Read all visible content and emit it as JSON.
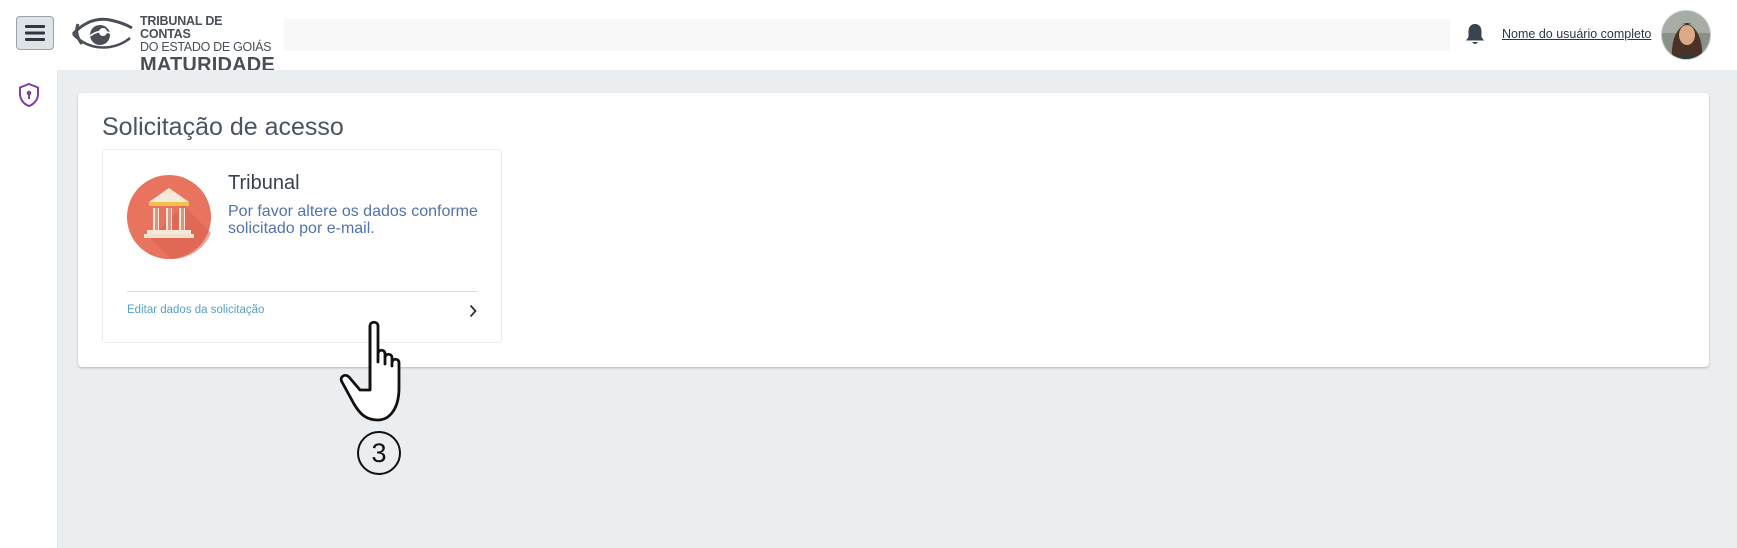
{
  "header": {
    "logo": {
      "line1": "TRIBUNAL DE CONTAS",
      "line2": "DO ESTADO DE GOIÁS",
      "line3": "MATURIDADE"
    },
    "user_name": "Nome do usuário completo"
  },
  "sidebar": {
    "items": [
      {
        "icon": "shield-lock-icon",
        "color": "#7e3fa3"
      }
    ]
  },
  "main": {
    "title": "Solicitação de acesso",
    "card": {
      "title": "Tribunal",
      "description": "Por favor altere os dados conforme solicitado por e-mail.",
      "link_label": "Editar dados da solicitação",
      "icon": "courthouse-icon",
      "icon_bg": "#e8735f"
    }
  },
  "annotation": {
    "step": "3"
  },
  "colors": {
    "accent": "#5aa0c7",
    "content_bg": "#ebeef0",
    "description": "#5272b3"
  }
}
